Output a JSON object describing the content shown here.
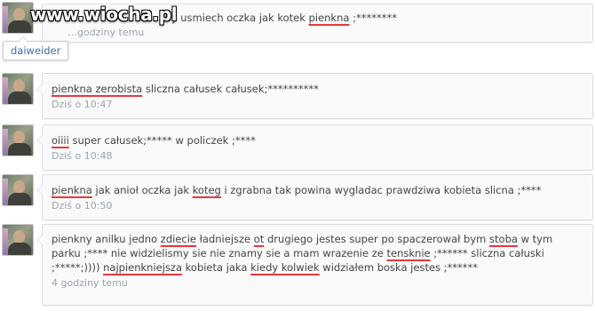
{
  "watermark": "www.wiocha.pl",
  "tooltip": "daiweider",
  "comments": [
    {
      "parts": [
        "…ny usmiech oczka jak kotek ",
        "pienkna",
        " ;********"
      ],
      "time": "…godziny temu"
    },
    {
      "parts": [
        "pienkna zerobista",
        " sliczna całusek całusek;**********"
      ],
      "time": "Dziś o 10:47"
    },
    {
      "parts": [
        "oiiii",
        " super całusek;***** w policzek ;****"
      ],
      "time": "Dziś o 10:48"
    },
    {
      "parts": [
        "pienkna",
        " jak anioł oczka jak ",
        "koteg",
        " i zgrabna tak powina wygladac prawdziwa kobieta slicna ;****"
      ],
      "time": "Dziś o 10:50"
    },
    {
      "parts": [
        "pienkny anilku jedno ",
        "zdiecie",
        " ładniejsze ",
        "ot",
        " drugiego jestes super po spaczerował bym ",
        "stoba",
        " w tym parku ;**** nie widzielismy sie nie znamy sie a mam wrazenie ze ",
        "tensknie",
        " ;****** sliczna całuski ;*****;)))) ",
        "najpienkniejsza",
        " kobieta jaka ",
        "kiedy kolwiek",
        " widziałem boska jestes ;******"
      ],
      "time": "4 godziny temu"
    }
  ],
  "colors": {
    "underline": "#e8383d",
    "meta": "#9aa3ad",
    "tooltip_text": "#3b6fa8"
  }
}
